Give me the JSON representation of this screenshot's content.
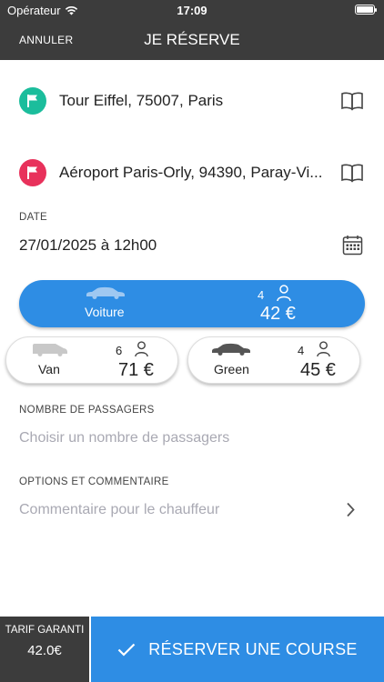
{
  "status": {
    "carrier": "Opérateur",
    "time": "17:09"
  },
  "nav": {
    "cancel": "ANNULER",
    "title": "JE RÉSERVE"
  },
  "pickup": {
    "address": "Tour Eiffel, 75007, Paris",
    "color": "#1bbd9c"
  },
  "dropoff": {
    "address": "Aéroport Paris-Orly, 94390, Paray-Vi...",
    "color": "#e8315b"
  },
  "date": {
    "label": "DATE",
    "value": "27/01/2025 à 12h00"
  },
  "vehicles": [
    {
      "name": "Voiture",
      "seats": "4",
      "price": "42 €",
      "selected": true
    },
    {
      "name": "Van",
      "seats": "6",
      "price": "71 €",
      "selected": false
    },
    {
      "name": "Green",
      "seats": "4",
      "price": "45 €",
      "selected": false
    }
  ],
  "passengers": {
    "label": "NOMBRE DE PASSAGERS",
    "placeholder": "Choisir un nombre de passagers"
  },
  "options": {
    "label": "OPTIONS ET COMMENTAIRE",
    "placeholder": "Commentaire pour le chauffeur"
  },
  "footer": {
    "tarif_label": "TARIF GARANTI",
    "tarif_value": "42.0€",
    "reserve_label": "RÉSERVER UNE COURSE"
  },
  "colors": {
    "accent": "#2e8de4",
    "dark": "#3c3c3c"
  },
  "icons": [
    "wifi-icon",
    "battery-icon",
    "flag-icon",
    "book-icon",
    "calendar-icon",
    "car-icon",
    "van-icon",
    "person-icon",
    "chevron-right-icon",
    "checkmark-icon"
  ]
}
